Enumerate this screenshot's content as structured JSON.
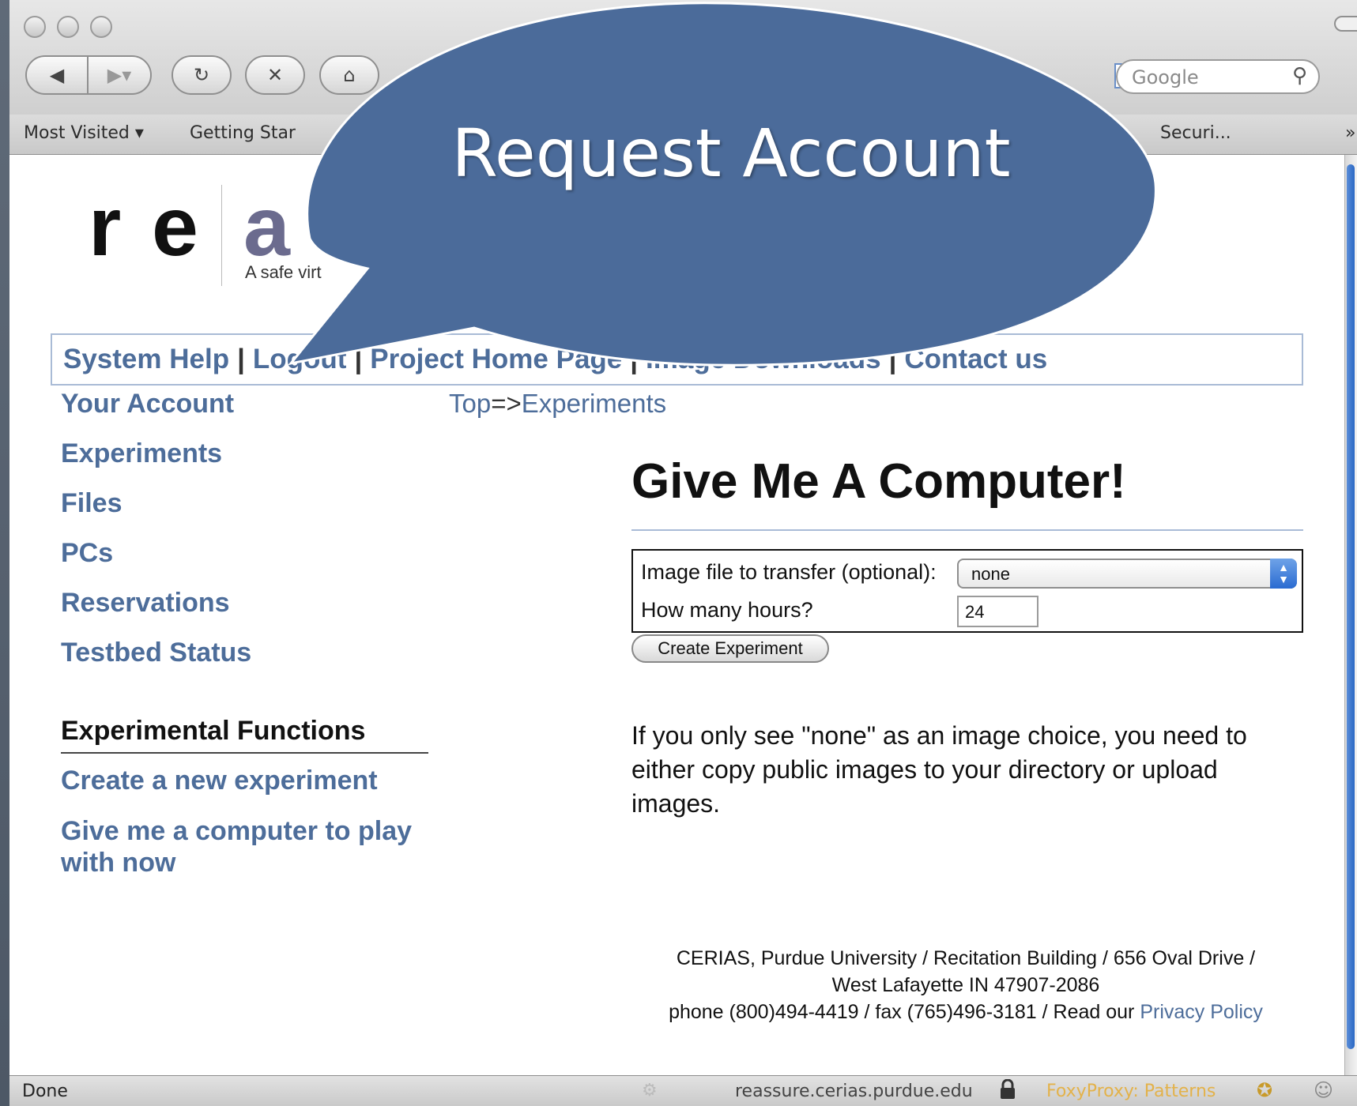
{
  "browser": {
    "search_placeholder": "Google",
    "bookmarks": {
      "most_visited": "Most Visited ▾",
      "getting_started": "Getting Star",
      "securi": "Securi..."
    },
    "status": {
      "done": "Done",
      "host": "reassure.cerias.purdue.edu",
      "proxy": "FoxyProxy: Patterns"
    }
  },
  "callout": {
    "text": "Request Account",
    "color": "#4b6b9a"
  },
  "site": {
    "logo_letters": [
      "r",
      "e",
      "a"
    ],
    "tagline": "A safe virt",
    "nav": {
      "system_help": "System Help",
      "logout": "Logout",
      "project_home": "Project Home Page",
      "image_downloads": "Image Downloads",
      "contact": "Contact us"
    },
    "breadcrumb": {
      "top": "Top",
      "arrow": "=>",
      "experiments": "Experiments"
    },
    "sidebar": {
      "your_account": "Your Account",
      "experiments": "Experiments",
      "files": "Files",
      "pcs": "PCs",
      "reservations": "Reservations",
      "testbed_status": "Testbed Status",
      "experimental_heading": "Experimental Functions",
      "create_new": "Create a new experiment",
      "give_me_line1": "Give me a computer to play",
      "give_me_line2": "with now"
    },
    "main": {
      "title": "Give Me A Computer!",
      "image_label": "Image file to transfer (optional):",
      "image_value": "none",
      "hours_label": "How many hours?",
      "hours_value": "24",
      "create_button": "Create Experiment",
      "note": "If you only see \"none\" as an image choice, you need to either copy public images to your directory or upload images."
    },
    "footer": {
      "line1": "CERIAS, Purdue University / Recitation Building / 656 Oval Drive /",
      "line2": "West Lafayette IN 47907-2086",
      "line3": "phone (800)494-4419 / fax (765)496-3181 / Read our",
      "privacy": "Privacy Policy"
    },
    "colors": {
      "link": "#4d6d9a",
      "logo_accent": "#6b6b8e"
    }
  }
}
